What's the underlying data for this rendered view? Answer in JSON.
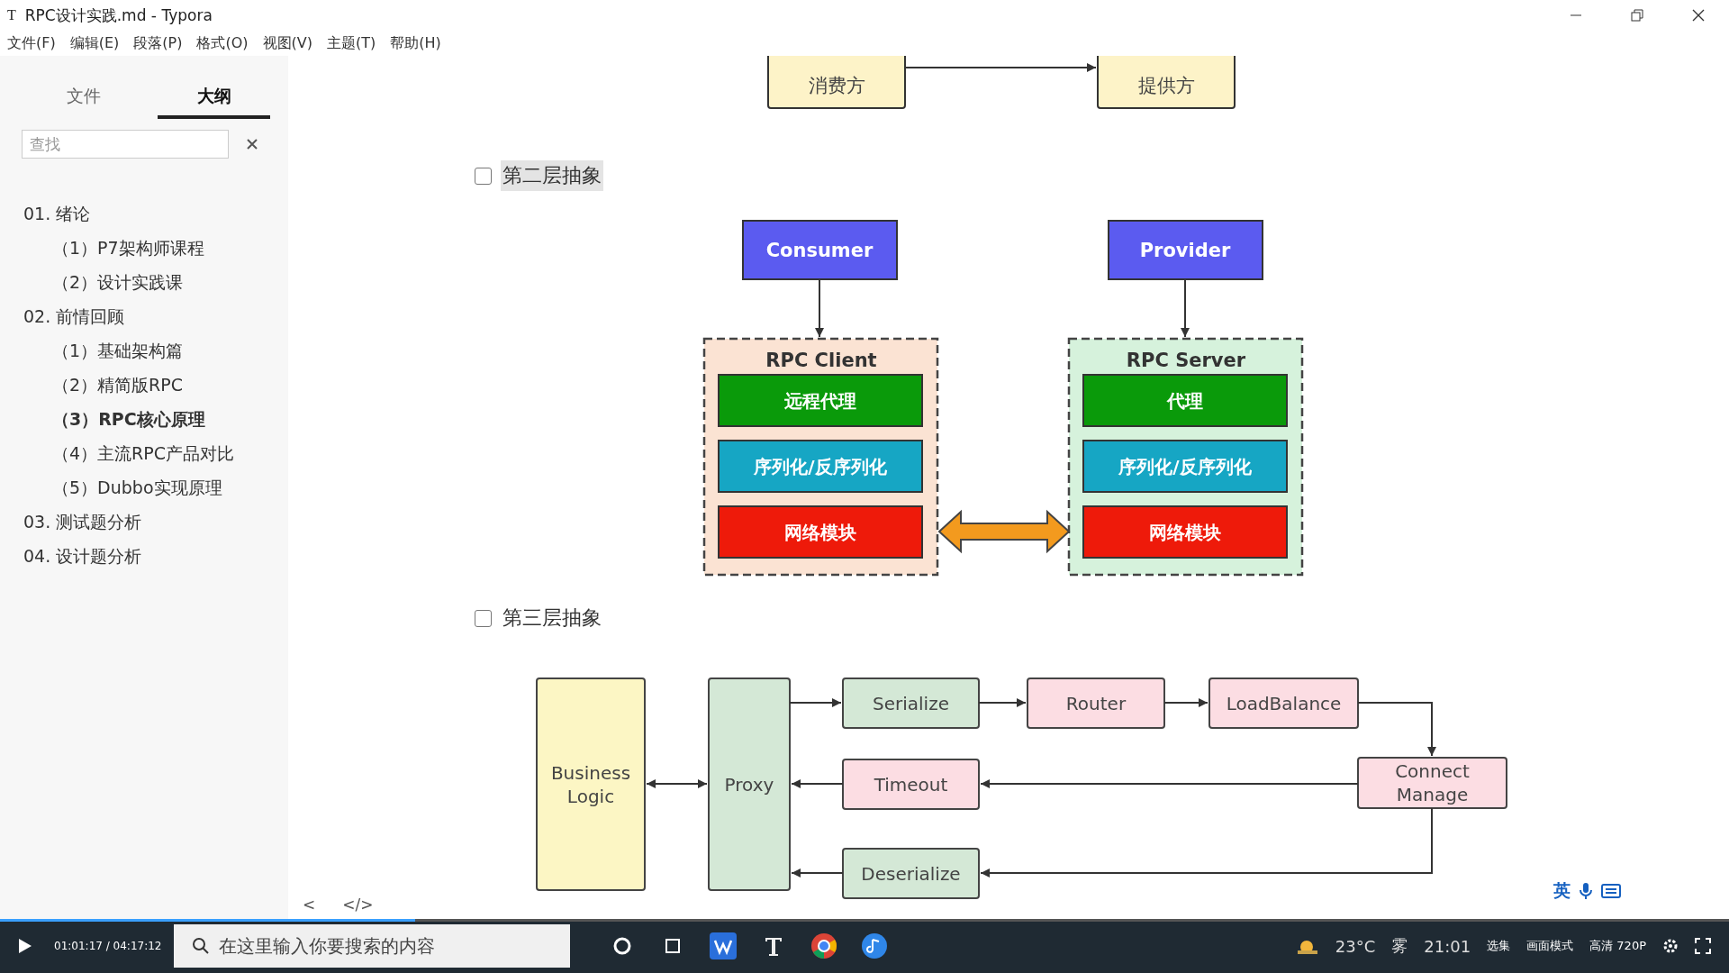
{
  "window": {
    "title": "RPC设计实践.md - Typora",
    "app_icon": "T"
  },
  "menu": [
    "文件(F)",
    "编辑(E)",
    "段落(P)",
    "格式(O)",
    "视图(V)",
    "主题(T)",
    "帮助(H)"
  ],
  "sidebar": {
    "tabs": [
      {
        "label": "文件",
        "selected": false
      },
      {
        "label": "大纲",
        "selected": true
      }
    ],
    "search": {
      "placeholder": "查找"
    },
    "outline": [
      {
        "label": "01. 绪论",
        "selected": false,
        "children": [
          {
            "label": "（1）P7架构师课程",
            "selected": false
          },
          {
            "label": "（2）设计实践课",
            "selected": false
          }
        ]
      },
      {
        "label": "02. 前情回顾",
        "selected": false,
        "children": [
          {
            "label": "（1）基础架构篇",
            "selected": false
          },
          {
            "label": "（2）精简版RPC",
            "selected": false
          },
          {
            "label": "（3）RPC核心原理",
            "selected": true
          },
          {
            "label": "（4）主流RPC产品对比",
            "selected": false
          },
          {
            "label": "（5）Dubbo实现原理",
            "selected": false
          }
        ]
      },
      {
        "label": "03. 测试题分析",
        "selected": false
      },
      {
        "label": "04. 设计题分析",
        "selected": false
      }
    ],
    "footer": [
      "<",
      "</>"
    ]
  },
  "document": {
    "top_diagram": {
      "nodes": [
        "消费方",
        "提供方"
      ]
    },
    "sections": [
      {
        "label": "第二层抽象",
        "checked": false,
        "selected": true
      },
      {
        "label": "第三层抽象",
        "checked": false,
        "selected": false
      }
    ],
    "layer_diagram": {
      "consumer": "Consumer",
      "provider": "Provider",
      "sides": [
        {
          "title": "RPC Client",
          "color": "#fbe3d3",
          "layers": [
            {
              "label": "远程代理",
              "color": "#0a9a0a"
            },
            {
              "label": "序列化/反序列化",
              "color": "#16a6c4"
            },
            {
              "label": "网络模块",
              "color": "#ee1a0a"
            }
          ]
        },
        {
          "title": "RPC Server",
          "color": "#d6f2dc",
          "layers": [
            {
              "label": "代理",
              "color": "#0a9a0a"
            },
            {
              "label": "序列化/反序列化",
              "color": "#16a6c4"
            },
            {
              "label": "网络模块",
              "color": "#ee1a0a"
            }
          ]
        }
      ]
    },
    "flow_diagram": {
      "nodes": [
        {
          "label": "Business Logic",
          "color": "#fcf6c4"
        },
        {
          "label": "Proxy",
          "color": "#d4e8d6"
        },
        {
          "label": "Serialize",
          "color": "#d4e8d6"
        },
        {
          "label": "Router",
          "color": "#fcdde3"
        },
        {
          "label": "LoadBalance",
          "color": "#fcdde3"
        },
        {
          "label": "Timeout",
          "color": "#fcdde3"
        },
        {
          "label": "Connect Manage",
          "color": "#fcdde3"
        },
        {
          "label": "Deserialize",
          "color": "#d4e8d6"
        }
      ]
    }
  },
  "taskbar": {
    "search_placeholder": "在这里输入你要搜索的内容",
    "temperature": "23°C",
    "weather": "雾",
    "clock": "21:01",
    "ime": "英"
  },
  "player": {
    "time": "01:01:17 / 04:17:12",
    "level": 0.24,
    "buttons": [
      "选集",
      "画面模式",
      "高清 720P"
    ]
  }
}
